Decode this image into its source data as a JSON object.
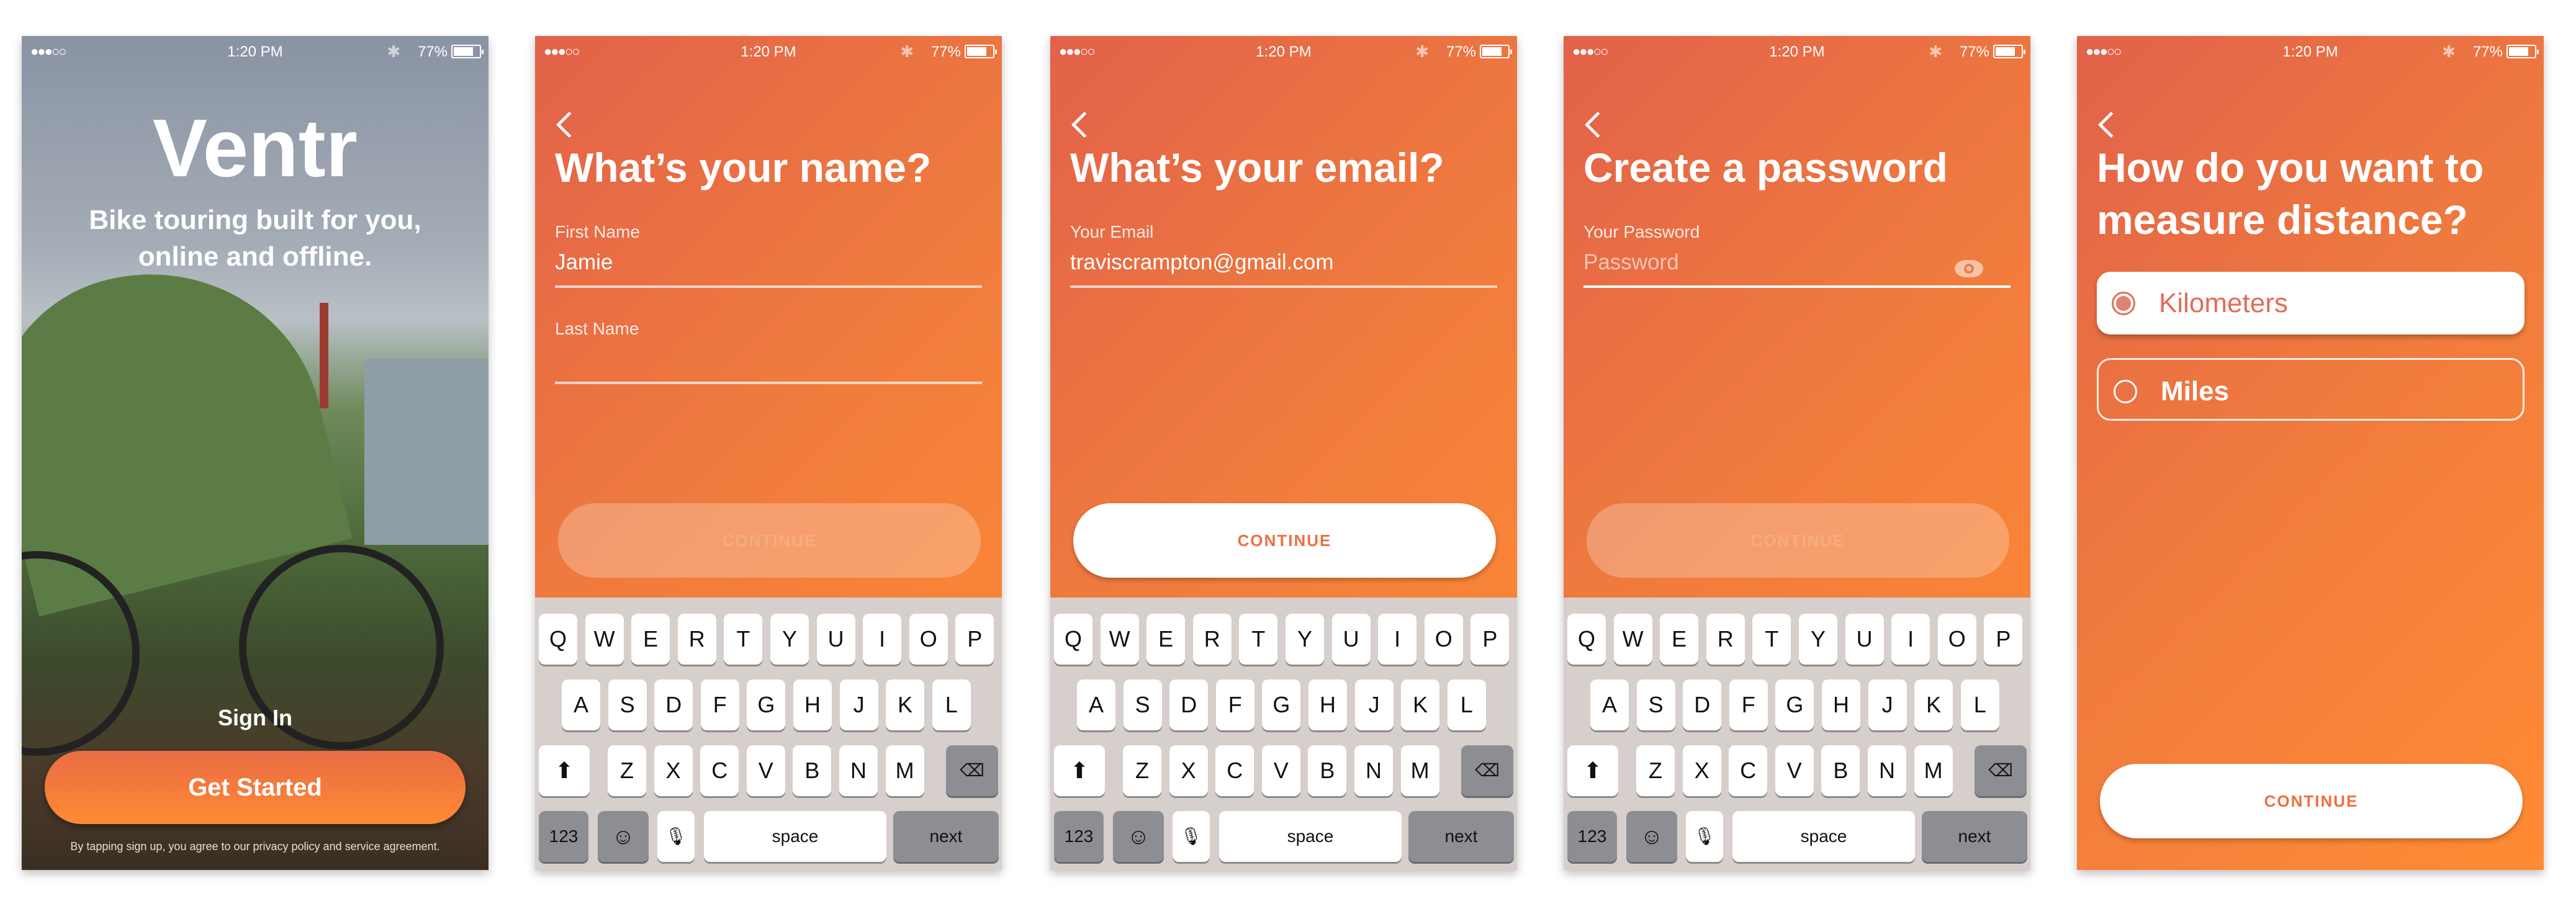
{
  "status": {
    "signal": "●●●○○",
    "time": "1:20 PM",
    "bluetooth": "bluetooth-icon",
    "battery": "77%"
  },
  "welcome": {
    "logo": "Ventr",
    "tagline_1": "Bike touring built for you,",
    "tagline_2": "online and offline.",
    "sign_in": "Sign In",
    "get_started": "Get Started",
    "terms": "By tapping sign up, you agree to our privacy policy and service agreement."
  },
  "name": {
    "title": "What’s your name?",
    "first_label": "First Name",
    "first_value": "Jamie",
    "last_label": "Last Name",
    "last_value": "",
    "continue": "CONTINUE"
  },
  "email": {
    "title": "What’s your email?",
    "label": "Your Email",
    "value": "traviscrampton@gmail.com",
    "continue": "CONTINUE"
  },
  "password": {
    "title": "Create a password",
    "label": "Your Password",
    "placeholder": "Password",
    "continue": "CONTINUE"
  },
  "distance": {
    "title_1": "How do you want to",
    "title_2": "measure distance?",
    "options": [
      {
        "label": "Kilometers",
        "selected": true
      },
      {
        "label": "Miles",
        "selected": false
      }
    ],
    "continue": "CONTINUE"
  },
  "keyboard": {
    "row1": [
      "Q",
      "W",
      "E",
      "R",
      "T",
      "Y",
      "U",
      "I",
      "O",
      "P"
    ],
    "row2": [
      "A",
      "S",
      "D",
      "F",
      "G",
      "H",
      "J",
      "K",
      "L"
    ],
    "row3": [
      "Z",
      "X",
      "C",
      "V",
      "B",
      "N",
      "M"
    ],
    "numbers": "123",
    "space": "space",
    "next": "next"
  },
  "colors": {
    "gradient_start": "#e2614a",
    "gradient_end": "#ff8b34",
    "keyboard_bg": "#d6cfcc",
    "selected_text": "#e26d55"
  }
}
